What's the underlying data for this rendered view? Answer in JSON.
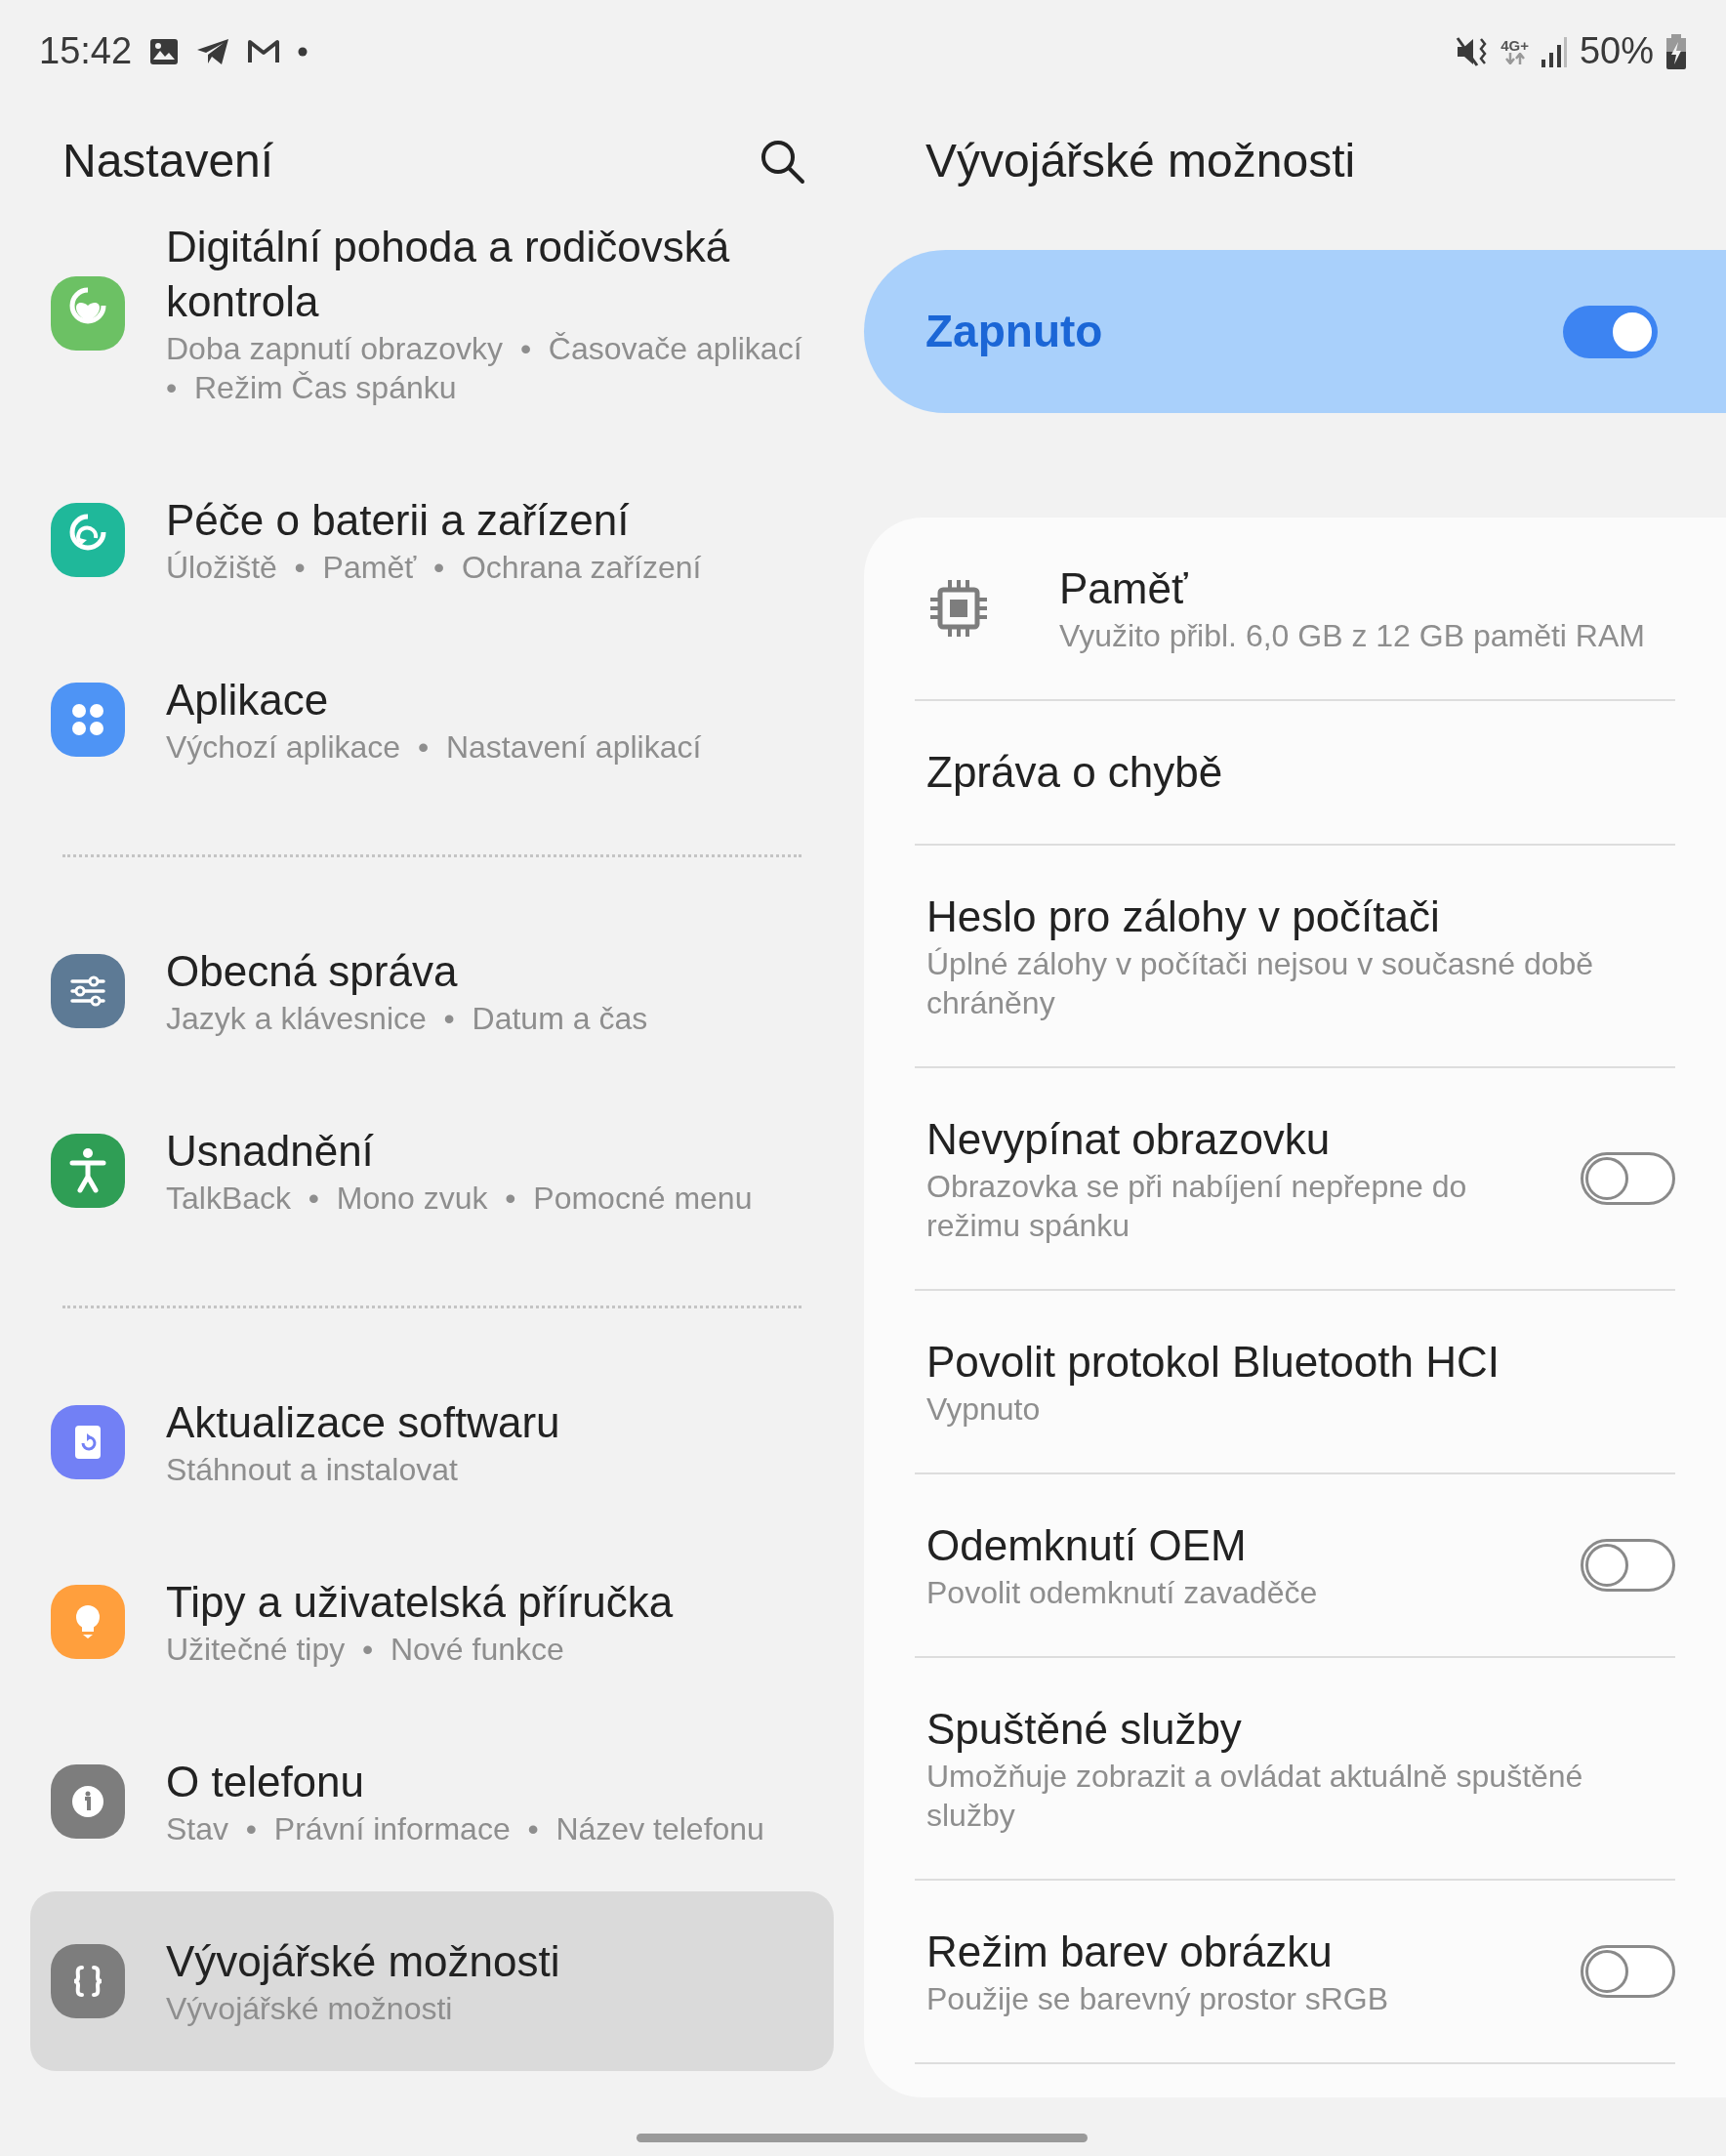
{
  "status_bar": {
    "time": "15:42",
    "network": "4G+",
    "battery": "50%"
  },
  "settings": {
    "title": "Nastavení",
    "groups": [
      [
        {
          "title": "Digitální pohoda a rodičovská kontrola",
          "subtitle": "Doba zapnutí obrazovky  •  Časovače aplikací  •  Režim Čas spánku",
          "color": "#6cc164",
          "selected": false
        },
        {
          "title": "Péče o baterii a zařízení",
          "subtitle": "Úložiště  •  Paměť  •  Ochrana zařízení",
          "color": "#1fb89a",
          "selected": false
        },
        {
          "title": "Aplikace",
          "subtitle": "Výchozí aplikace  •  Nastavení aplikací",
          "color": "#4e94f5",
          "selected": false
        }
      ],
      [
        {
          "title": "Obecná správa",
          "subtitle": "Jazyk a klávesnice  •  Datum a čas",
          "color": "#5d7a95",
          "selected": false
        },
        {
          "title": "Usnadnění",
          "subtitle": "TalkBack  •  Mono zvuk  •  Pomocné menu",
          "color": "#2f9e55",
          "selected": false
        }
      ],
      [
        {
          "title": "Aktualizace softwaru",
          "subtitle": "Stáhnout a instalovat",
          "color": "#7280f5",
          "selected": false
        },
        {
          "title": "Tipy a uživatelská příručka",
          "subtitle": "Užitečné tipy  •  Nové funkce",
          "color": "#ff9f3d",
          "selected": false
        },
        {
          "title": "O telefonu",
          "subtitle": "Stav  •  Právní informace  •  Název telefonu",
          "color": "#7d7d7d",
          "selected": false
        },
        {
          "title": "Vývojářské možnosti",
          "subtitle": "Vývojářské možnosti",
          "color": "#7d7d7d",
          "selected": true
        }
      ]
    ]
  },
  "developer_options": {
    "title": "Vývojářské možnosti",
    "master_switch": {
      "label": "Zapnuto",
      "on": true
    },
    "options": [
      {
        "kind": "memory",
        "title": "Paměť",
        "subtitle": "Využito přibl. 6,0 GB z 12 GB paměti RAM"
      },
      {
        "kind": "plain",
        "title": "Zpráva o chybě"
      },
      {
        "kind": "plain",
        "title": "Heslo pro zálohy v počítači",
        "subtitle": "Úplné zálohy v počítači nejsou v současné době chráněny"
      },
      {
        "kind": "toggle",
        "title": "Nevypínat obrazovku",
        "subtitle": "Obrazovka se při nabíjení nepřepne do režimu spánku",
        "on": false
      },
      {
        "kind": "plain",
        "title": "Povolit protokol Bluetooth HCI",
        "subtitle": "Vypnuto"
      },
      {
        "kind": "toggle",
        "title": "Odemknutí OEM",
        "subtitle": "Povolit odemknutí zavaděče",
        "on": false
      },
      {
        "kind": "plain",
        "title": "Spuštěné služby",
        "subtitle": "Umožňuje zobrazit a ovládat aktuálně spuštěné služby"
      },
      {
        "kind": "toggle",
        "title": "Režim barev obrázku",
        "subtitle": "Použije se barevný prostor sRGB",
        "on": false
      }
    ]
  }
}
